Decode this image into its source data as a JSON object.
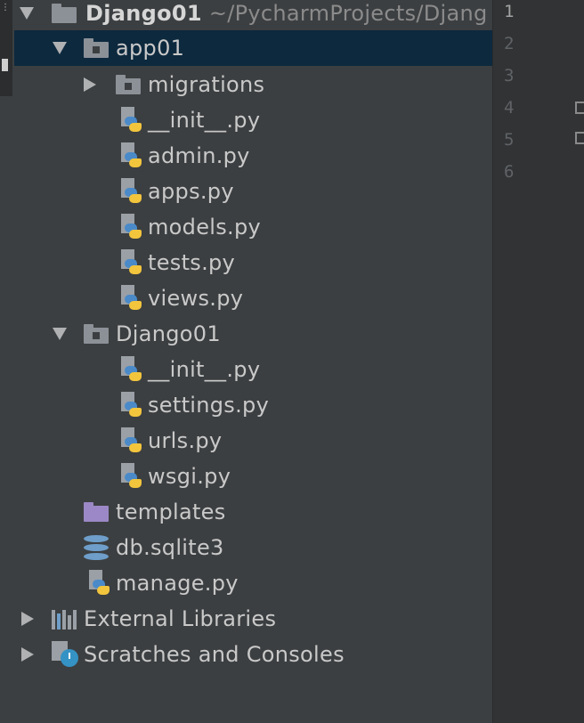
{
  "left_strip": {
    "glyph": "⋮"
  },
  "tree": {
    "root": {
      "name": "Django01",
      "path": "~/PycharmProjects/Djang"
    },
    "app_folder": "app01",
    "app_children": {
      "migrations": "migrations",
      "files": [
        "__init__.py",
        "admin.py",
        "apps.py",
        "models.py",
        "tests.py",
        "views.py"
      ]
    },
    "project_folder": "Django01",
    "project_files": [
      "__init__.py",
      "settings.py",
      "urls.py",
      "wsgi.py"
    ],
    "templates": "templates",
    "db": "db.sqlite3",
    "manage": "manage.py",
    "external_libraries": "External Libraries",
    "scratches": "Scratches and Consoles"
  },
  "gutter": {
    "line_numbers": [
      "1",
      "2",
      "3",
      "4",
      "5",
      "6"
    ]
  }
}
